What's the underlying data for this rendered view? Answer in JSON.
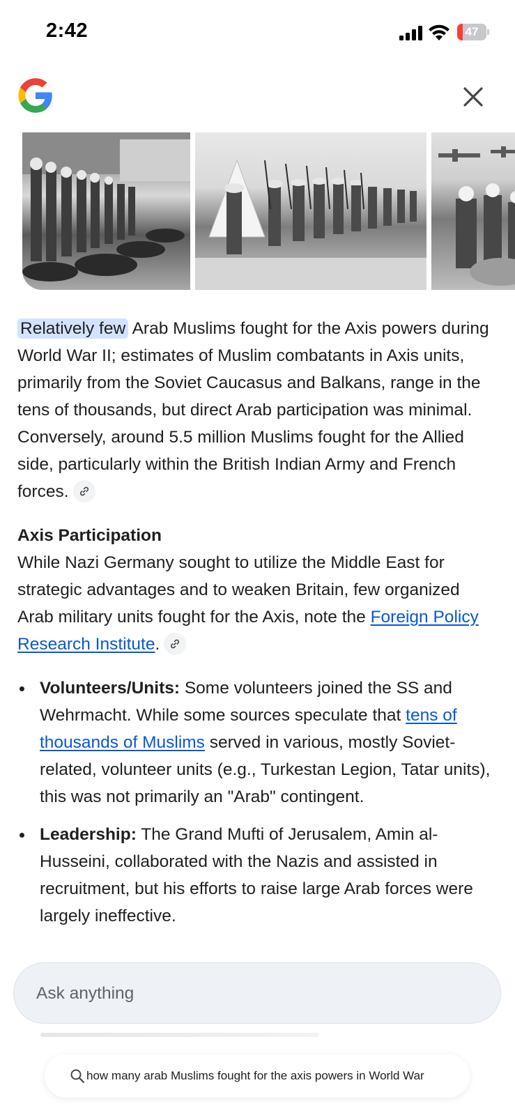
{
  "status_bar": {
    "time": "2:42",
    "battery_level": "47",
    "icons": [
      "cellular-signal-icon",
      "wifi-icon",
      "battery-icon"
    ]
  },
  "header": {
    "logo_icon": "google-g-icon",
    "close_icon": "close-icon"
  },
  "carousel": {
    "images": [
      "soldiers-lined-up-photo",
      "soldiers-marching-photo",
      "soldiers-and-aircraft-photo"
    ]
  },
  "article": {
    "intro_highlight": "Relatively few",
    "intro_rest": " Arab Muslims fought for the Axis powers during World War II; estimates of Muslim combatants in Axis units, primarily from the Soviet Caucasus and Balkans, range in the tens of thousands, but direct Arab participation was minimal. Conversely, around 5.5 million Muslims fought for the Allied side, particularly within the British Indian Army and French forces.",
    "section_title": "Axis Participation",
    "section_text_before": "While Nazi Germany sought to utilize the Middle East for strategic advantages and to weaken Britain, few organized Arab military units fought for the Axis, note the ",
    "section_link": "Foreign Policy Research Institute",
    "section_text_after": ".",
    "bullets": [
      {
        "label": "Volunteers/Units:",
        "text_before": " Some volunteers joined the SS and Wehrmacht. While some sources speculate that ",
        "link": "tens of thousands of Muslims",
        "text_after": " served in various, mostly Soviet-related, volunteer units (e.g., Turkestan Legion, Tatar units), this was not primarily an \"Arab\" contingent."
      },
      {
        "label": "Leadership:",
        "text": " The Grand Mufti of Jerusalem, Amin al-Husseini, collaborated with the Nazis and assisted in recruitment, but his efforts to raise large Arab forces were largely ineffective."
      }
    ]
  },
  "ask_box": {
    "placeholder": "Ask anything"
  },
  "query_pill": {
    "text": "how many arab Muslims fought for the axis powers in World War"
  },
  "colors": {
    "link": "#0b57d0",
    "highlight": "#d3e3fd",
    "text": "#1f1f1f"
  }
}
